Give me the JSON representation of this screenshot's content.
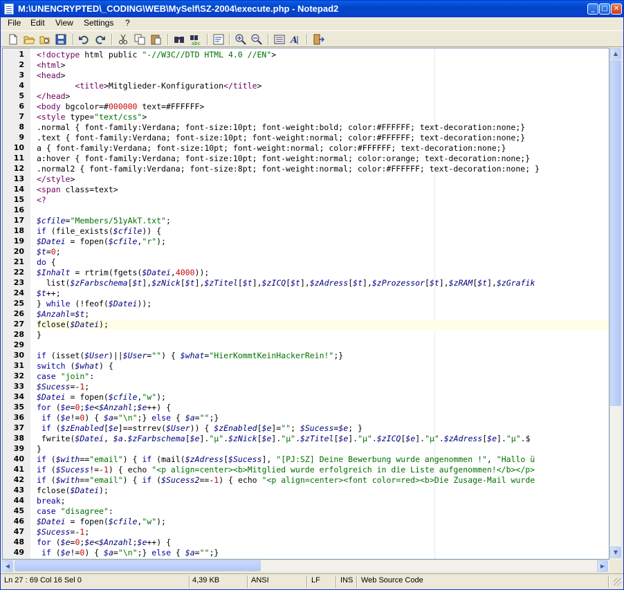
{
  "window": {
    "title": "M:\\UNENCRYPTED\\_CODING\\WEB\\MySelf\\SZ-2004\\execute.php - Notepad2",
    "controls": [
      "minimize-button",
      "maximize-button",
      "close-button"
    ]
  },
  "menu": [
    {
      "label": "File",
      "underline": "F"
    },
    {
      "label": "Edit",
      "underline": "E"
    },
    {
      "label": "View",
      "underline": "V"
    },
    {
      "label": "Settings",
      "underline": "S"
    },
    {
      "label": "?",
      "underline": "?"
    }
  ],
  "toolbar": {
    "icons": [
      "new-icon",
      "open-icon",
      "browse-icon",
      "save-icon",
      "undo-icon",
      "redo-icon",
      "cut-icon",
      "copy-icon",
      "paste-icon",
      "find-icon",
      "replace-icon",
      "wordwrap-icon",
      "zoom-in-icon",
      "zoom-out-icon",
      "scheme-icon",
      "customize-scheme-icon",
      "exit-icon"
    ]
  },
  "editor": {
    "line_numbers": [
      "1",
      "2",
      "3",
      "4",
      "5",
      "6",
      "7",
      "8",
      "9",
      "10",
      "11",
      "12",
      "13",
      "14",
      "15",
      "16",
      "17",
      "18",
      "19",
      "20",
      "21",
      "22",
      "23",
      "24",
      "25",
      "26",
      "27",
      "28",
      "29",
      "30",
      "31",
      "32",
      "33",
      "34",
      "35",
      "36",
      "37",
      "38",
      "39",
      "40",
      "41",
      "42",
      "43",
      "44",
      "45",
      "46",
      "47",
      "48",
      "49"
    ],
    "current_line": 27,
    "lines": [
      "<!doctype html public \"-//W3C//DTD HTML 4.0 //EN\">",
      "<html>",
      "<head>",
      "        <title>Mitglieder-Konfiguration</title>",
      "</head>",
      "<body bgcolor=#000000 text=#FFFFFF>",
      "<style type=\"text/css\">",
      ".normal { font-family:Verdana; font-size:10pt; font-weight:bold; color:#FFFFFF; text-decoration:none;}",
      ".text { font-family:Verdana; font-size:10pt; font-weight:normal; color:#FFFFFF; text-decoration:none;}",
      "a { font-family:Verdana; font-size:10pt; font-weight:normal; color:#FFFFFF; text-decoration:none;}",
      "a:hover { font-family:Verdana; font-size:10pt; font-weight:normal; color:orange; text-decoration:none;}",
      ".normal2 { font-family:Verdana; font-size:8pt; font-weight:normal; color:#FFFFFF; text-decoration:none; }",
      "</style>",
      "<span class=text>",
      "<?",
      "",
      "$cfile=\"Members/51yAkT.txt\";",
      "if (file_exists($cfile)) {",
      "$Datei = fopen($cfile,\"r\");",
      "$t=0;",
      "do {",
      "$Inhalt = rtrim(fgets($Datei,4000));",
      "  list($zFarbschema[$t],$zNick[$t],$zTitel[$t],$zICQ[$t],$zAdress[$t],$zProzessor[$t],$zRAM[$t],$zGrafik",
      "$t++;",
      "} while (!feof($Datei));",
      "$Anzahl=$t;",
      "fclose($Datei);",
      "}",
      "",
      "if (isset($User)||$User=\"\") { $what=\"HierKommtKeinHackerRein!\";}",
      "switch ($what) {",
      "case \"join\":",
      "$Sucess=-1;",
      "$Datei = fopen($cfile,\"w\");",
      "for ($e=0;$e<$Anzahl;$e++) {",
      " if ($e!=0) { $a=\"\\n\";} else { $a=\"\";}",
      " if ($zEnabled[$e]==strrev($User)) { $zEnabled[$e]=\"\"; $Sucess=$e; }",
      " fwrite($Datei, $a.$zFarbschema[$e].\"µ\".$zNick[$e].\"µ\".$zTitel[$e].\"µ\".$zICQ[$e].\"µ\".$zAdress[$e].\"µ\".$",
      "}",
      "if ($with==\"email\") { if (mail($zAdress[$Sucess], \"[PJ:SZ] Deine Bewerbung wurde angenommen !\", \"Hallo ü",
      "if ($Sucess!=-1) { echo \"<p align=center><b>Mitglied wurde erfolgreich in die Liste aufgenommen!</b></p>",
      "if ($with==\"email\") { if ($Sucess2==-1) { echo \"<p align=center><font color=red><b>Die Zusage-Mail wurde",
      "fclose($Datei);",
      "break;",
      "case \"disagree\":",
      "$Datei = fopen($cfile,\"w\");",
      "$Sucess=-1;",
      "for ($e=0;$e<$Anzahl;$e++) {",
      " if ($e!=0) { $a=\"\\n\";} else { $a=\"\";}"
    ]
  },
  "statusbar": {
    "position": "Ln 27 : 69   Col 16   Sel 0",
    "size": "4,39 KB",
    "encoding": "ANSI",
    "line_ending": "LF",
    "insert_mode": "INS",
    "scheme": "Web Source Code"
  }
}
